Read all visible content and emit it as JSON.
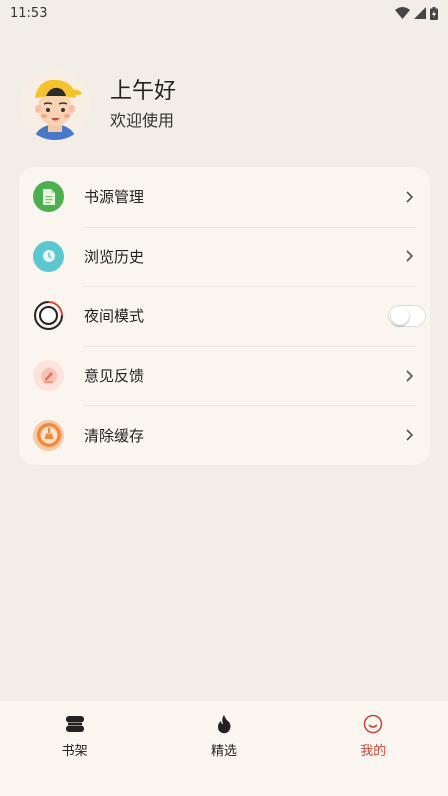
{
  "status_bar": {
    "time": "11:53"
  },
  "profile": {
    "greeting": "上午好",
    "subtitle": "欢迎使用"
  },
  "menu": {
    "items": [
      {
        "label": "书源管理",
        "icon": "document-icon",
        "color": "#4caf50",
        "has_chevron": true
      },
      {
        "label": "浏览历史",
        "icon": "clock-icon",
        "color": "#5bc8d0",
        "has_chevron": true
      },
      {
        "label": "夜间模式",
        "icon": "night-mode-icon",
        "color": "#e0463a",
        "toggle_on": false
      },
      {
        "label": "意见反馈",
        "icon": "feedback-pen-icon",
        "color": "#f08a7a",
        "has_chevron": true
      },
      {
        "label": "清除缓存",
        "icon": "broom-icon",
        "color": "#f28a3c",
        "has_chevron": true
      }
    ]
  },
  "bottom_nav": {
    "items": [
      {
        "label": "书架",
        "icon": "bookshelf-icon",
        "active": false
      },
      {
        "label": "精选",
        "icon": "flame-icon",
        "active": false
      },
      {
        "label": "我的",
        "icon": "smiley-icon",
        "active": true
      }
    ],
    "active_color": "#c94a3d"
  }
}
